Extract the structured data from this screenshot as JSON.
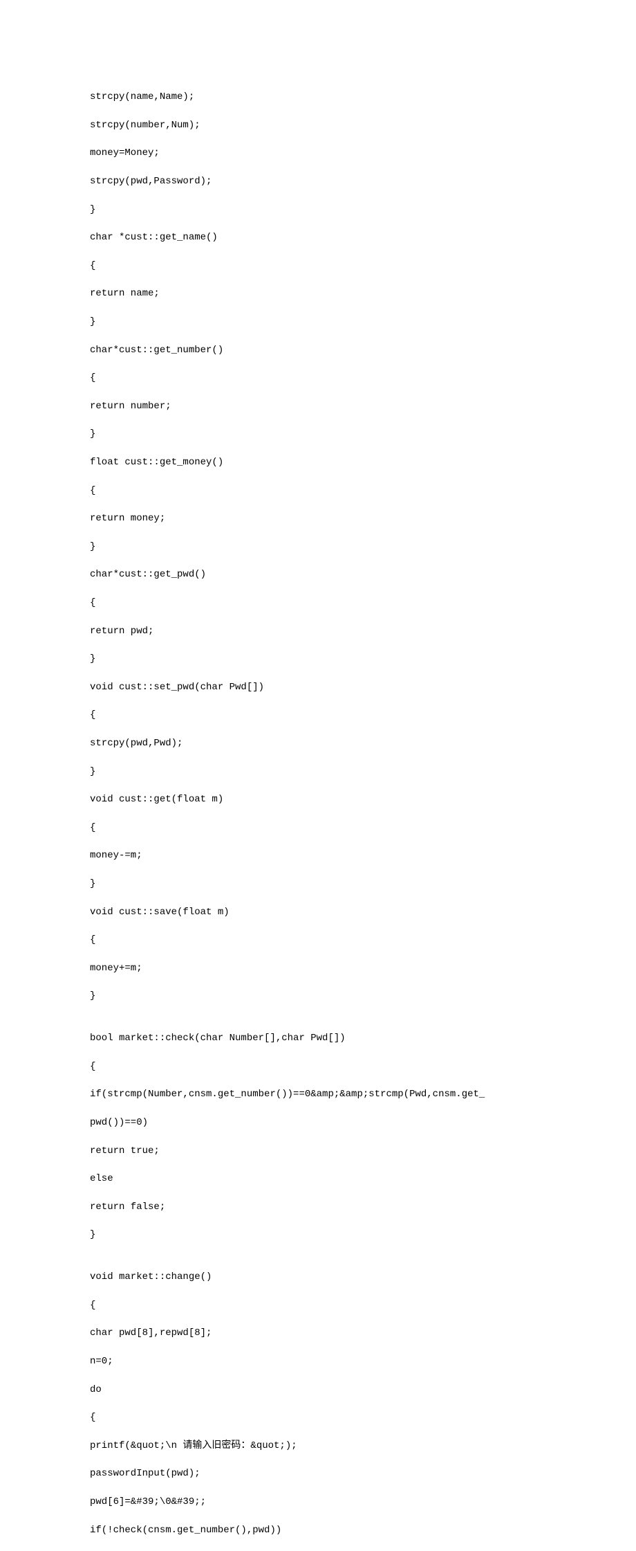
{
  "lines": [
    "strcpy(name,Name);",
    "strcpy(number,Num);",
    "money=Money;",
    "strcpy(pwd,Password);",
    "}",
    "char *cust::get_name()",
    "{",
    "return name;",
    "}",
    "char*cust::get_number()",
    "{",
    "return number;",
    "}",
    "float cust::get_money()",
    "{",
    "return money;",
    "}",
    "char*cust::get_pwd()",
    "{",
    "return pwd;",
    "}",
    "void cust::set_pwd(char Pwd[])",
    "{",
    "strcpy(pwd,Pwd);",
    "}",
    "void cust::get(float m)",
    "{",
    "money-=m;",
    "}",
    "void cust::save(float m)",
    "{",
    "money+=m;",
    "}",
    "",
    "bool market::check(char Number[],char Pwd[])",
    "{",
    "if(strcmp(Number,cnsm.get_number())==0&amp;&amp;strcmp(Pwd,cnsm.get_",
    "pwd())==0)",
    "return true;",
    "else",
    "return false;",
    "}",
    "",
    "void market::change()",
    "{",
    "char pwd[8],repwd[8];",
    "n=0;",
    "do",
    "{",
    "printf(&quot;\\n 请输入旧密码：&quot;);",
    "passwordInput(pwd);",
    "pwd[6]=&#39;\\0&#39;;",
    "if(!check(cnsm.get_number(),pwd))"
  ]
}
